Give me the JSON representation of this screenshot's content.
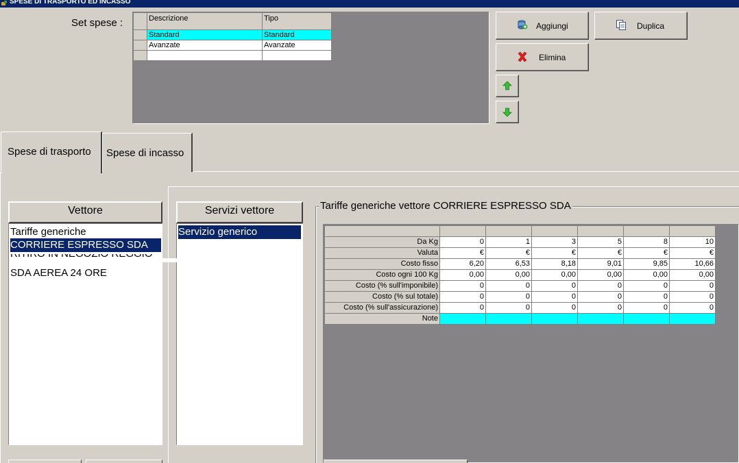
{
  "window": {
    "title": "SPESE DI TRASPORTO ED INCASSO"
  },
  "setspese": {
    "label": "Set spese :",
    "columns": [
      "Descrizione",
      "Tipo"
    ],
    "rows": [
      [
        "Standard",
        "Standard"
      ],
      [
        "Avanzate",
        "Avanzate"
      ],
      [
        "",
        ""
      ]
    ],
    "selected_row": 0
  },
  "buttons": {
    "aggiungi": "Aggiungi",
    "duplica": "Duplica",
    "elimina": "Elimina"
  },
  "tabs": [
    "Spese di trasporto",
    "Spese di incasso"
  ],
  "vettore": {
    "header": "Vettore",
    "items": [
      "Tariffe generiche",
      "CORRIERE ESPRESSO SDA",
      "RITIRO IN NEGOZIO REGGIO",
      "SDA AEREA 24 ORE"
    ],
    "selected": 1
  },
  "servizi": {
    "header": "Servizi vettore",
    "items": [
      "Servizio generico"
    ],
    "selected": 0
  },
  "tariffe": {
    "title": "Tariffe generiche vettore CORRIERE ESPRESSO SDA",
    "rows": [
      {
        "label": "Da Kg",
        "values": [
          "0",
          "1",
          "3",
          "5",
          "8",
          "10"
        ]
      },
      {
        "label": "Valuta",
        "values": [
          "€",
          "€",
          "€",
          "€",
          "€",
          "€"
        ]
      },
      {
        "label": "Costo fisso",
        "values": [
          "6,20",
          "6,53",
          "8,18",
          "9,01",
          "9,85",
          "10,66"
        ]
      },
      {
        "label": "Costo ogni 100 Kg",
        "values": [
          "0,00",
          "0,00",
          "0,00",
          "0,00",
          "0,00",
          "0,00"
        ]
      },
      {
        "label": "Costo (% sull'imponibile)",
        "values": [
          "0",
          "0",
          "0",
          "0",
          "0",
          "0"
        ]
      },
      {
        "label": "Costo (% sul totale)",
        "values": [
          "0",
          "0",
          "0",
          "0",
          "0",
          "0"
        ]
      },
      {
        "label": "Costo (% sull'assicurazione)",
        "values": [
          "0",
          "0",
          "0",
          "0",
          "0",
          "0"
        ]
      },
      {
        "label": "Note",
        "values": [
          "",
          "",
          "",
          "",
          "",
          ""
        ]
      }
    ]
  },
  "colors": {
    "selection": "#0a246a",
    "grid_highlight": "#00ffff",
    "face": "#d4d0c8",
    "grid_bg": "#858385"
  }
}
